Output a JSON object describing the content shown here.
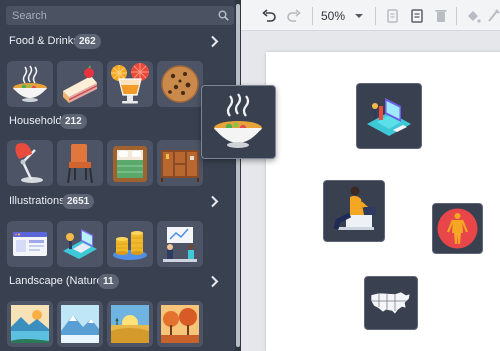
{
  "library": {
    "search": {
      "placeholder": "Search",
      "icon": "search-icon"
    },
    "categories": [
      {
        "title": "Food & Drinks",
        "count": "262",
        "items": [
          "bowl-of-soup",
          "cake-slice",
          "orange-drink",
          "chocolate-cookie"
        ]
      },
      {
        "title": "Household",
        "count": "212",
        "items": [
          "desk-lamp",
          "chair",
          "bed",
          "cabinet"
        ]
      },
      {
        "title": "Illustrations",
        "count": "2651",
        "items": [
          "browser-window",
          "isometric-laptop",
          "coins-stack",
          "team-meeting"
        ]
      },
      {
        "title": "Landscape (Nature)",
        "count": "11",
        "items": [
          "sunny-lake",
          "snowy-mountains",
          "desert-sunset",
          "autumn-forest"
        ]
      }
    ]
  },
  "toolbar": {
    "undo_icon": "undo-icon",
    "redo_icon": "redo-icon",
    "zoom": "50%",
    "icons": [
      "copy-icon",
      "paste-icon",
      "delete-icon",
      "fill-bucket-icon",
      "line-color-icon"
    ]
  },
  "canvas": {
    "drag_item": "bowl-of-soup",
    "shapes": [
      "isometric-phone-illustration",
      "person-with-laptop",
      "human-body-anatomy",
      "usa-map"
    ]
  },
  "colors": {
    "panel": "#394150",
    "tile": "#4c5465",
    "badge": "#5d6474",
    "accent_red": "#e9464a",
    "accent_cyan": "#3ec8d8",
    "accent_orange": "#f0a52a"
  }
}
